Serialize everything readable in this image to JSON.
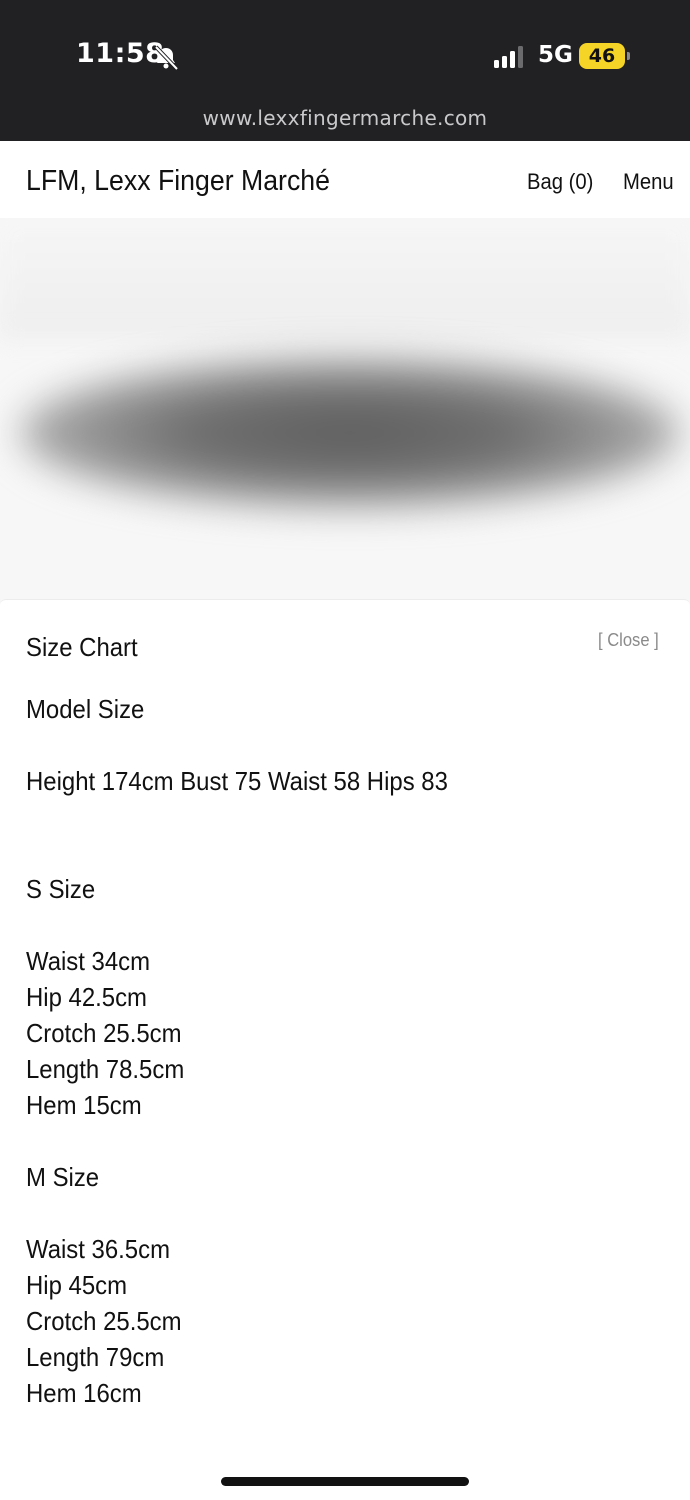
{
  "status_bar": {
    "time": "11:58",
    "network": "5G",
    "battery": "46",
    "battery_color": "#f5d327",
    "icons": [
      "bell-slash-icon",
      "signal-icon",
      "battery-icon"
    ]
  },
  "browser": {
    "url": "www.lexxfingermarche.com"
  },
  "header": {
    "brand": "LFM, Lexx Finger Marché",
    "bag": "Bag (0)",
    "menu": "Menu"
  },
  "size_chart": {
    "title": "Size Chart",
    "close": "[ Close ]",
    "model_size_heading": "Model Size",
    "model_size_details": "Height 174cm Bust 75 Waist 58 Hips 83",
    "sizes": [
      {
        "heading": "S Size",
        "lines": [
          "Waist 34cm",
          "Hip 42.5cm",
          "Crotch 25.5cm",
          "Length 78.5cm",
          "Hem 15cm"
        ]
      },
      {
        "heading": "M Size",
        "lines": [
          "Waist 36.5cm",
          "Hip 45cm",
          "Crotch 25.5cm",
          "Length 79cm",
          "Hem 16cm"
        ]
      }
    ]
  }
}
